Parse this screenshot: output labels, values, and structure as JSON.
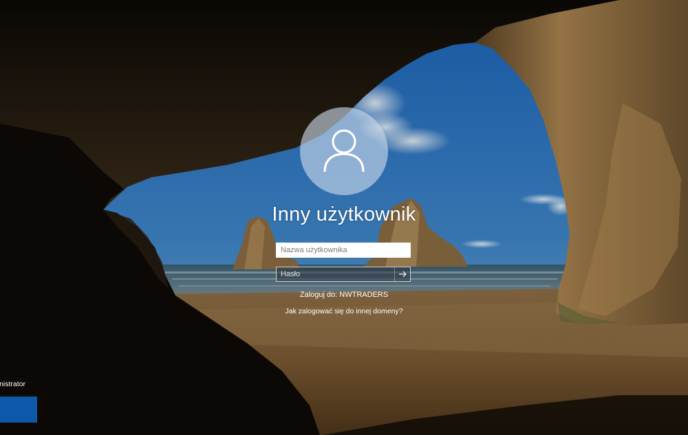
{
  "login": {
    "user_name": "Inny użytkownik",
    "username_placeholder": "Nazwa użytkownika",
    "password_placeholder": "Hasło",
    "sign_in_to": "Zaloguj do: NWTRADERS",
    "other_domain_link": "Jak zalogować się do innej domeny?"
  },
  "user_list": {
    "user_label": "ministrator"
  },
  "icons": {
    "avatar": "user-silhouette-icon",
    "submit": "arrow-right-icon"
  },
  "colors": {
    "user_tile": "#0d58a8",
    "avatar_circle": "#cddceb"
  }
}
